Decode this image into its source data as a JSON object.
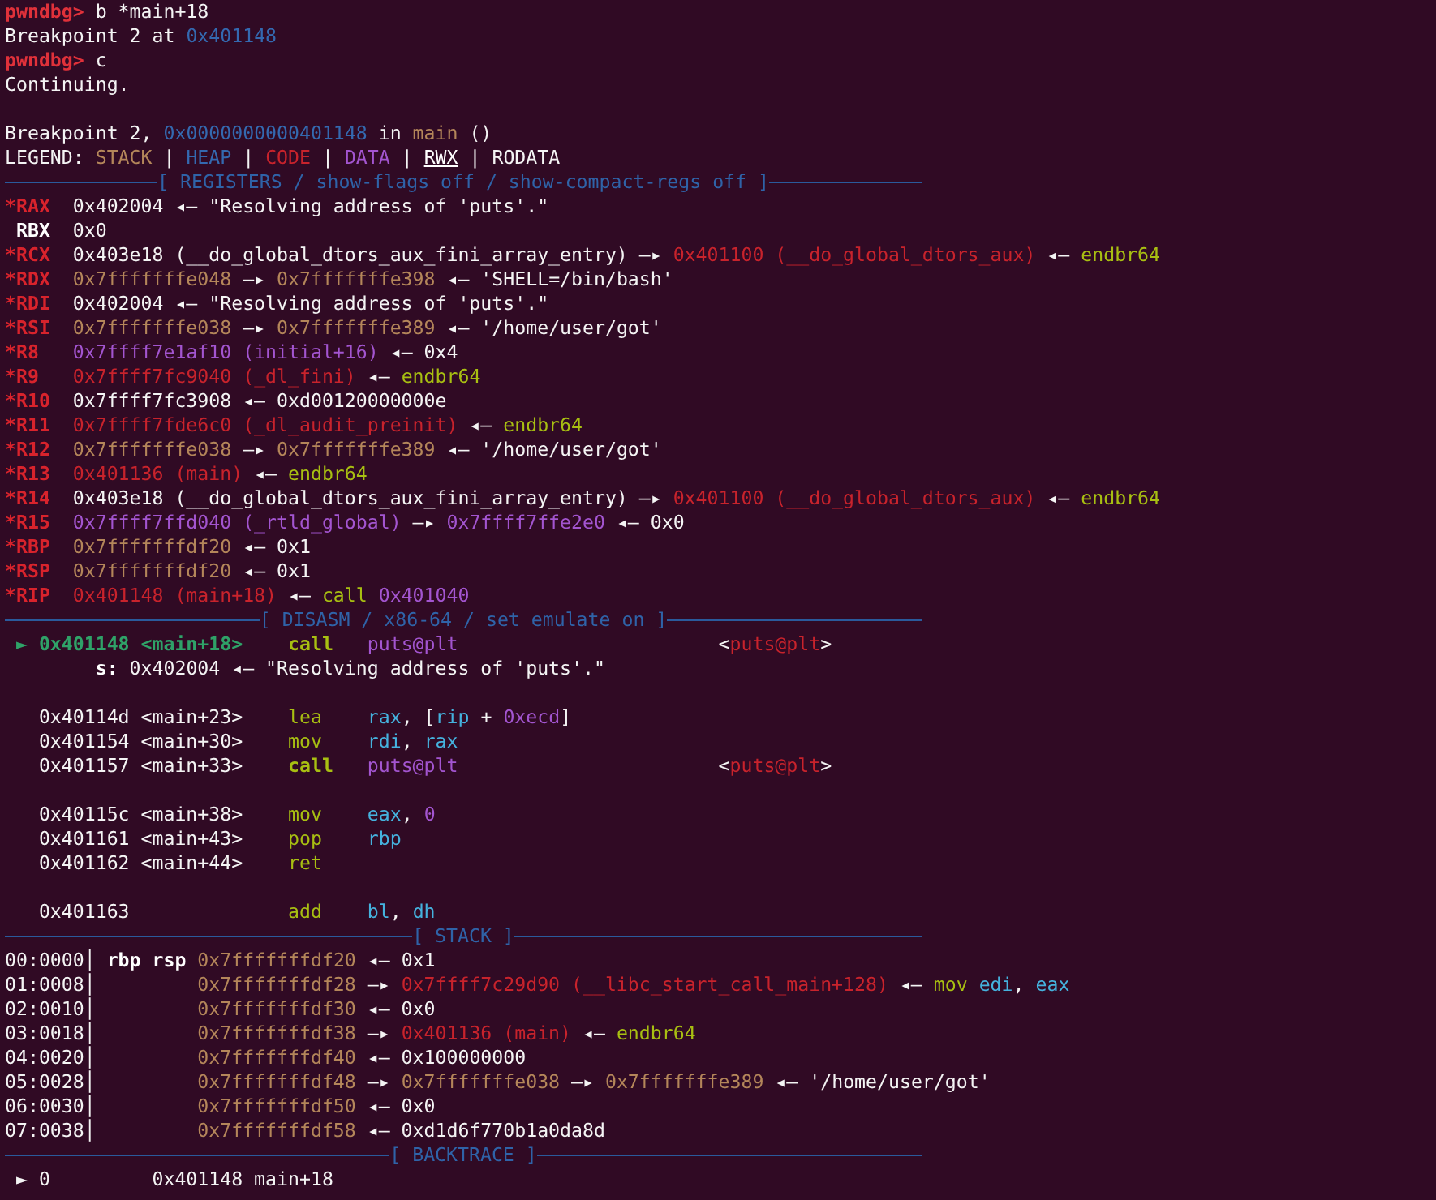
{
  "terminal": {
    "lines": [
      {
        "kind": "text",
        "spans": [
          {
            "kind": "prompt",
            "text": "pwndbg> "
          },
          {
            "kind": "plain",
            "text": "b *main+18"
          }
        ]
      },
      {
        "kind": "text",
        "spans": [
          {
            "kind": "plain",
            "text": "Breakpoint 2 at "
          },
          {
            "kind": "heap",
            "text": "0x401148"
          }
        ]
      },
      {
        "kind": "text",
        "spans": [
          {
            "kind": "prompt",
            "text": "pwndbg> "
          },
          {
            "kind": "plain",
            "text": "c"
          }
        ]
      },
      {
        "kind": "text",
        "spans": [
          {
            "kind": "plain",
            "text": "Continuing."
          }
        ]
      },
      {
        "kind": "blank"
      },
      {
        "kind": "text",
        "spans": [
          {
            "kind": "plain",
            "text": "Breakpoint 2, "
          },
          {
            "kind": "heap",
            "text": "0x0000000000401148"
          },
          {
            "kind": "plain",
            "text": " in "
          },
          {
            "kind": "stack",
            "text": "main"
          },
          {
            "kind": "plain",
            "text": " ()"
          }
        ]
      },
      {
        "kind": "text",
        "spans": [
          {
            "kind": "plain",
            "text": "LEGEND: "
          },
          {
            "kind": "stack",
            "text": "STACK"
          },
          {
            "kind": "plain",
            "text": " | "
          },
          {
            "kind": "heap",
            "text": "HEAP"
          },
          {
            "kind": "plain",
            "text": " | "
          },
          {
            "kind": "code",
            "text": "CODE"
          },
          {
            "kind": "plain",
            "text": " | "
          },
          {
            "kind": "data",
            "text": "DATA"
          },
          {
            "kind": "plain",
            "text": " | "
          },
          {
            "kind": "rwx",
            "text": "RWX"
          },
          {
            "kind": "plain",
            "text": " | RODATA"
          }
        ]
      },
      {
        "kind": "divider",
        "title": "[ REGISTERS / show-flags off / show-compact-regs off ]"
      },
      {
        "kind": "text",
        "spans": [
          {
            "kind": "reg",
            "text": "*RAX"
          },
          {
            "kind": "plain",
            "text": "  0x402004 ◂— \"Resolving address of 'puts'.\""
          }
        ]
      },
      {
        "kind": "text",
        "spans": [
          {
            "kind": "bold",
            "text": " RBX"
          },
          {
            "kind": "plain",
            "text": "  0x0"
          }
        ]
      },
      {
        "kind": "text",
        "spans": [
          {
            "kind": "reg",
            "text": "*RCX"
          },
          {
            "kind": "plain",
            "text": "  0x403e18 (__do_global_dtors_aux_fini_array_entry) —▸ "
          },
          {
            "kind": "code",
            "text": "0x401100 (__do_global_dtors_aux)"
          },
          {
            "kind": "plain",
            "text": " ◂— "
          },
          {
            "kind": "insn",
            "text": "endbr64"
          }
        ]
      },
      {
        "kind": "text",
        "spans": [
          {
            "kind": "reg",
            "text": "*RDX"
          },
          {
            "kind": "stack",
            "text": "  0x7fffffffe048"
          },
          {
            "kind": "plain",
            "text": " —▸ "
          },
          {
            "kind": "stack",
            "text": "0x7fffffffe398"
          },
          {
            "kind": "plain",
            "text": " ◂— 'SHELL=/bin/bash'"
          }
        ]
      },
      {
        "kind": "text",
        "spans": [
          {
            "kind": "reg",
            "text": "*RDI"
          },
          {
            "kind": "plain",
            "text": "  0x402004 ◂— \"Resolving address of 'puts'.\""
          }
        ]
      },
      {
        "kind": "text",
        "spans": [
          {
            "kind": "reg",
            "text": "*RSI"
          },
          {
            "kind": "stack",
            "text": "  0x7fffffffe038"
          },
          {
            "kind": "plain",
            "text": " —▸ "
          },
          {
            "kind": "stack",
            "text": "0x7fffffffe389"
          },
          {
            "kind": "plain",
            "text": " ◂— '/home/user/got'"
          }
        ]
      },
      {
        "kind": "text",
        "spans": [
          {
            "kind": "reg",
            "text": "*R8"
          },
          {
            "kind": "data",
            "text": "   0x7ffff7e1af10 (initial+16)"
          },
          {
            "kind": "plain",
            "text": " ◂— 0x4"
          }
        ]
      },
      {
        "kind": "text",
        "spans": [
          {
            "kind": "reg",
            "text": "*R9"
          },
          {
            "kind": "code",
            "text": "   0x7ffff7fc9040 (_dl_fini)"
          },
          {
            "kind": "plain",
            "text": " ◂— "
          },
          {
            "kind": "insn",
            "text": "endbr64"
          }
        ]
      },
      {
        "kind": "text",
        "spans": [
          {
            "kind": "reg",
            "text": "*R10"
          },
          {
            "kind": "plain",
            "text": "  0x7ffff7fc3908 ◂— 0xd00120000000e"
          }
        ]
      },
      {
        "kind": "text",
        "spans": [
          {
            "kind": "reg",
            "text": "*R11"
          },
          {
            "kind": "code",
            "text": "  0x7ffff7fde6c0 (_dl_audit_preinit)"
          },
          {
            "kind": "plain",
            "text": " ◂— "
          },
          {
            "kind": "insn",
            "text": "endbr64"
          }
        ]
      },
      {
        "kind": "text",
        "spans": [
          {
            "kind": "reg",
            "text": "*R12"
          },
          {
            "kind": "stack",
            "text": "  0x7fffffffe038"
          },
          {
            "kind": "plain",
            "text": " —▸ "
          },
          {
            "kind": "stack",
            "text": "0x7fffffffe389"
          },
          {
            "kind": "plain",
            "text": " ◂— '/home/user/got'"
          }
        ]
      },
      {
        "kind": "text",
        "spans": [
          {
            "kind": "reg",
            "text": "*R13"
          },
          {
            "kind": "code",
            "text": "  0x401136 (main)"
          },
          {
            "kind": "plain",
            "text": " ◂— "
          },
          {
            "kind": "insn",
            "text": "endbr64"
          }
        ]
      },
      {
        "kind": "text",
        "spans": [
          {
            "kind": "reg",
            "text": "*R14"
          },
          {
            "kind": "plain",
            "text": "  0x403e18 (__do_global_dtors_aux_fini_array_entry) —▸ "
          },
          {
            "kind": "code",
            "text": "0x401100 (__do_global_dtors_aux)"
          },
          {
            "kind": "plain",
            "text": " ◂— "
          },
          {
            "kind": "insn",
            "text": "endbr64"
          }
        ]
      },
      {
        "kind": "text",
        "spans": [
          {
            "kind": "reg",
            "text": "*R15"
          },
          {
            "kind": "data",
            "text": "  0x7ffff7ffd040 (_rtld_global)"
          },
          {
            "kind": "plain",
            "text": " —▸ "
          },
          {
            "kind": "data",
            "text": "0x7ffff7ffe2e0"
          },
          {
            "kind": "plain",
            "text": " ◂— 0x0"
          }
        ]
      },
      {
        "kind": "text",
        "spans": [
          {
            "kind": "reg",
            "text": "*RBP"
          },
          {
            "kind": "stack",
            "text": "  0x7fffffffdf20"
          },
          {
            "kind": "plain",
            "text": " ◂— 0x1"
          }
        ]
      },
      {
        "kind": "text",
        "spans": [
          {
            "kind": "reg",
            "text": "*RSP"
          },
          {
            "kind": "stack",
            "text": "  0x7fffffffdf20"
          },
          {
            "kind": "plain",
            "text": " ◂— 0x1"
          }
        ]
      },
      {
        "kind": "text",
        "spans": [
          {
            "kind": "reg",
            "text": "*RIP"
          },
          {
            "kind": "code",
            "text": "  0x401148 (main+18)"
          },
          {
            "kind": "plain",
            "text": " ◂— "
          },
          {
            "kind": "insn",
            "text": "call"
          },
          {
            "kind": "data",
            "text": " 0x401040"
          }
        ]
      },
      {
        "kind": "divider",
        "title": "[ DISASM / x86-64 / set emulate on ]"
      },
      {
        "kind": "text",
        "spans": [
          {
            "kind": "current",
            "text": " ► 0x401148 <main+18>"
          },
          {
            "kind": "insn-bold",
            "text": "    call"
          },
          {
            "kind": "data",
            "text": "   puts@plt"
          },
          {
            "kind": "plain",
            "text": "                       <"
          },
          {
            "kind": "code",
            "text": "puts@plt"
          },
          {
            "kind": "plain",
            "text": ">"
          }
        ]
      },
      {
        "kind": "text",
        "spans": [
          {
            "kind": "bold",
            "text": "        s:"
          },
          {
            "kind": "plain",
            "text": " 0x402004 ◂— \"Resolving address of 'puts'.\""
          }
        ]
      },
      {
        "kind": "blank"
      },
      {
        "kind": "text",
        "spans": [
          {
            "kind": "plain",
            "text": "   0x40114d <main+23>    "
          },
          {
            "kind": "insn",
            "text": "lea"
          },
          {
            "kind": "op",
            "text": "    rax"
          },
          {
            "kind": "plain",
            "text": ", ["
          },
          {
            "kind": "op",
            "text": "rip"
          },
          {
            "kind": "plain",
            "text": " + "
          },
          {
            "kind": "data",
            "text": "0xecd"
          },
          {
            "kind": "plain",
            "text": "]"
          }
        ]
      },
      {
        "kind": "text",
        "spans": [
          {
            "kind": "plain",
            "text": "   0x401154 <main+30>    "
          },
          {
            "kind": "insn",
            "text": "mov"
          },
          {
            "kind": "op",
            "text": "    rdi"
          },
          {
            "kind": "plain",
            "text": ", "
          },
          {
            "kind": "op",
            "text": "rax"
          }
        ]
      },
      {
        "kind": "text",
        "spans": [
          {
            "kind": "plain",
            "text": "   0x401157 <main+33>    "
          },
          {
            "kind": "insn-bold",
            "text": "call"
          },
          {
            "kind": "data",
            "text": "   puts@plt"
          },
          {
            "kind": "plain",
            "text": "                       <"
          },
          {
            "kind": "code",
            "text": "puts@plt"
          },
          {
            "kind": "plain",
            "text": ">"
          }
        ]
      },
      {
        "kind": "blank"
      },
      {
        "kind": "text",
        "spans": [
          {
            "kind": "plain",
            "text": "   0x40115c <main+38>    "
          },
          {
            "kind": "insn",
            "text": "mov"
          },
          {
            "kind": "op",
            "text": "    eax"
          },
          {
            "kind": "plain",
            "text": ", "
          },
          {
            "kind": "data",
            "text": "0"
          }
        ]
      },
      {
        "kind": "text",
        "spans": [
          {
            "kind": "plain",
            "text": "   0x401161 <main+43>    "
          },
          {
            "kind": "insn",
            "text": "pop"
          },
          {
            "kind": "op",
            "text": "    rbp"
          }
        ]
      },
      {
        "kind": "text",
        "spans": [
          {
            "kind": "plain",
            "text": "   0x401162 <main+44>    "
          },
          {
            "kind": "insn",
            "text": "ret"
          }
        ]
      },
      {
        "kind": "blank"
      },
      {
        "kind": "text",
        "spans": [
          {
            "kind": "plain",
            "text": "   0x401163              "
          },
          {
            "kind": "insn",
            "text": "add"
          },
          {
            "kind": "op",
            "text": "    bl"
          },
          {
            "kind": "plain",
            "text": ", "
          },
          {
            "kind": "op",
            "text": "dh"
          }
        ]
      },
      {
        "kind": "divider",
        "title": "[ STACK ]"
      },
      {
        "kind": "text",
        "spans": [
          {
            "kind": "plain",
            "text": "00:0000│ "
          },
          {
            "kind": "bold",
            "text": "rbp rsp"
          },
          {
            "kind": "stack",
            "text": " 0x7fffffffdf20"
          },
          {
            "kind": "plain",
            "text": " ◂— 0x1"
          }
        ]
      },
      {
        "kind": "text",
        "spans": [
          {
            "kind": "plain",
            "text": "01:0008│"
          },
          {
            "kind": "stack",
            "text": "         0x7fffffffdf28"
          },
          {
            "kind": "plain",
            "text": " —▸ "
          },
          {
            "kind": "code",
            "text": "0x7ffff7c29d90 (__libc_start_call_main+128)"
          },
          {
            "kind": "plain",
            "text": " ◂— "
          },
          {
            "kind": "insn",
            "text": "mov"
          },
          {
            "kind": "op",
            "text": " edi"
          },
          {
            "kind": "plain",
            "text": ", "
          },
          {
            "kind": "op",
            "text": "eax"
          }
        ]
      },
      {
        "kind": "text",
        "spans": [
          {
            "kind": "plain",
            "text": "02:0010│"
          },
          {
            "kind": "stack",
            "text": "         0x7fffffffdf30"
          },
          {
            "kind": "plain",
            "text": " ◂— 0x0"
          }
        ]
      },
      {
        "kind": "text",
        "spans": [
          {
            "kind": "plain",
            "text": "03:0018│"
          },
          {
            "kind": "stack",
            "text": "         0x7fffffffdf38"
          },
          {
            "kind": "plain",
            "text": " —▸ "
          },
          {
            "kind": "code",
            "text": "0x401136 (main)"
          },
          {
            "kind": "plain",
            "text": " ◂— "
          },
          {
            "kind": "insn",
            "text": "endbr64"
          }
        ]
      },
      {
        "kind": "text",
        "spans": [
          {
            "kind": "plain",
            "text": "04:0020│"
          },
          {
            "kind": "stack",
            "text": "         0x7fffffffdf40"
          },
          {
            "kind": "plain",
            "text": " ◂— 0x100000000"
          }
        ]
      },
      {
        "kind": "text",
        "spans": [
          {
            "kind": "plain",
            "text": "05:0028│"
          },
          {
            "kind": "stack",
            "text": "         0x7fffffffdf48"
          },
          {
            "kind": "plain",
            "text": " —▸ "
          },
          {
            "kind": "stack",
            "text": "0x7fffffffe038"
          },
          {
            "kind": "plain",
            "text": " —▸ "
          },
          {
            "kind": "stack",
            "text": "0x7fffffffe389"
          },
          {
            "kind": "plain",
            "text": " ◂— '/home/user/got'"
          }
        ]
      },
      {
        "kind": "text",
        "spans": [
          {
            "kind": "plain",
            "text": "06:0030│"
          },
          {
            "kind": "stack",
            "text": "         0x7fffffffdf50"
          },
          {
            "kind": "plain",
            "text": " ◂— 0x0"
          }
        ]
      },
      {
        "kind": "text",
        "spans": [
          {
            "kind": "plain",
            "text": "07:0038│"
          },
          {
            "kind": "stack",
            "text": "         0x7fffffffdf58"
          },
          {
            "kind": "plain",
            "text": " ◂— 0xd1d6f770b1a0da8d"
          }
        ]
      },
      {
        "kind": "divider",
        "title": "[ BACKTRACE ]"
      },
      {
        "kind": "text",
        "spans": [
          {
            "kind": "plain",
            "text": " ► 0         0x401148 main+18"
          }
        ]
      }
    ]
  }
}
